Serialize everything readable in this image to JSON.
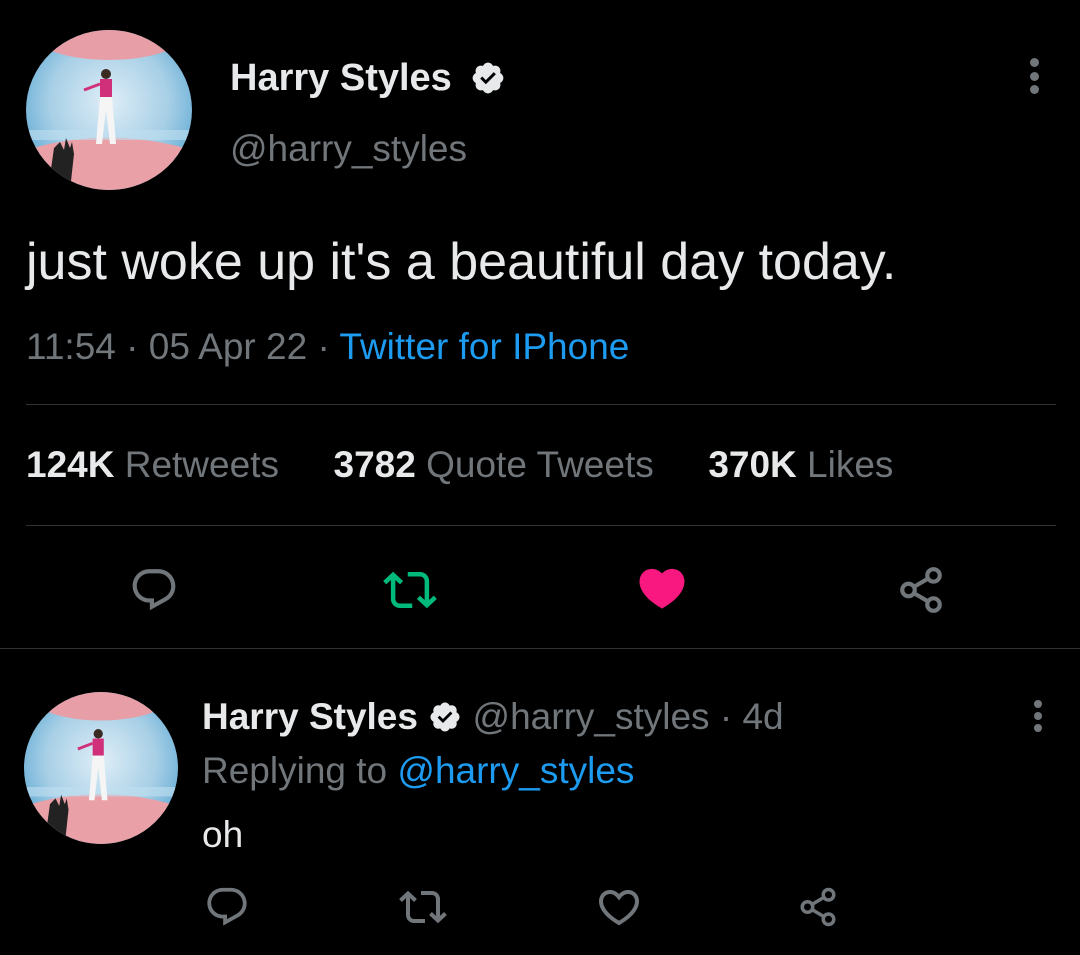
{
  "tweet": {
    "author_name": "Harry Styles",
    "handle": "@harry_styles",
    "text": "just woke up it's a beautiful day today.",
    "time": "11:54",
    "date": "05 Apr 22",
    "separator": "·",
    "source": "Twitter for IPhone",
    "stats": {
      "retweets_count": "124K",
      "retweets_label": "Retweets",
      "quotes_count": "3782",
      "quotes_label": "Quote Tweets",
      "likes_count": "370K",
      "likes_label": "Likes"
    },
    "liked": true
  },
  "reply": {
    "author_name": "Harry Styles",
    "handle": "@harry_styles",
    "separator": "·",
    "age": "4d",
    "replying_label": "Replying to",
    "replying_to": "@harry_styles",
    "text": "oh"
  },
  "colors": {
    "background": "#000000",
    "text": "#e7e9ea",
    "muted": "#71767b",
    "link": "#1d9bf0",
    "retweet_green": "#00ba7c",
    "like_red": "#f91880",
    "divider": "#2f3336"
  },
  "icons": [
    "verified-badge-icon",
    "more-icon",
    "reply-icon",
    "retweet-icon",
    "like-icon",
    "share-icon"
  ]
}
